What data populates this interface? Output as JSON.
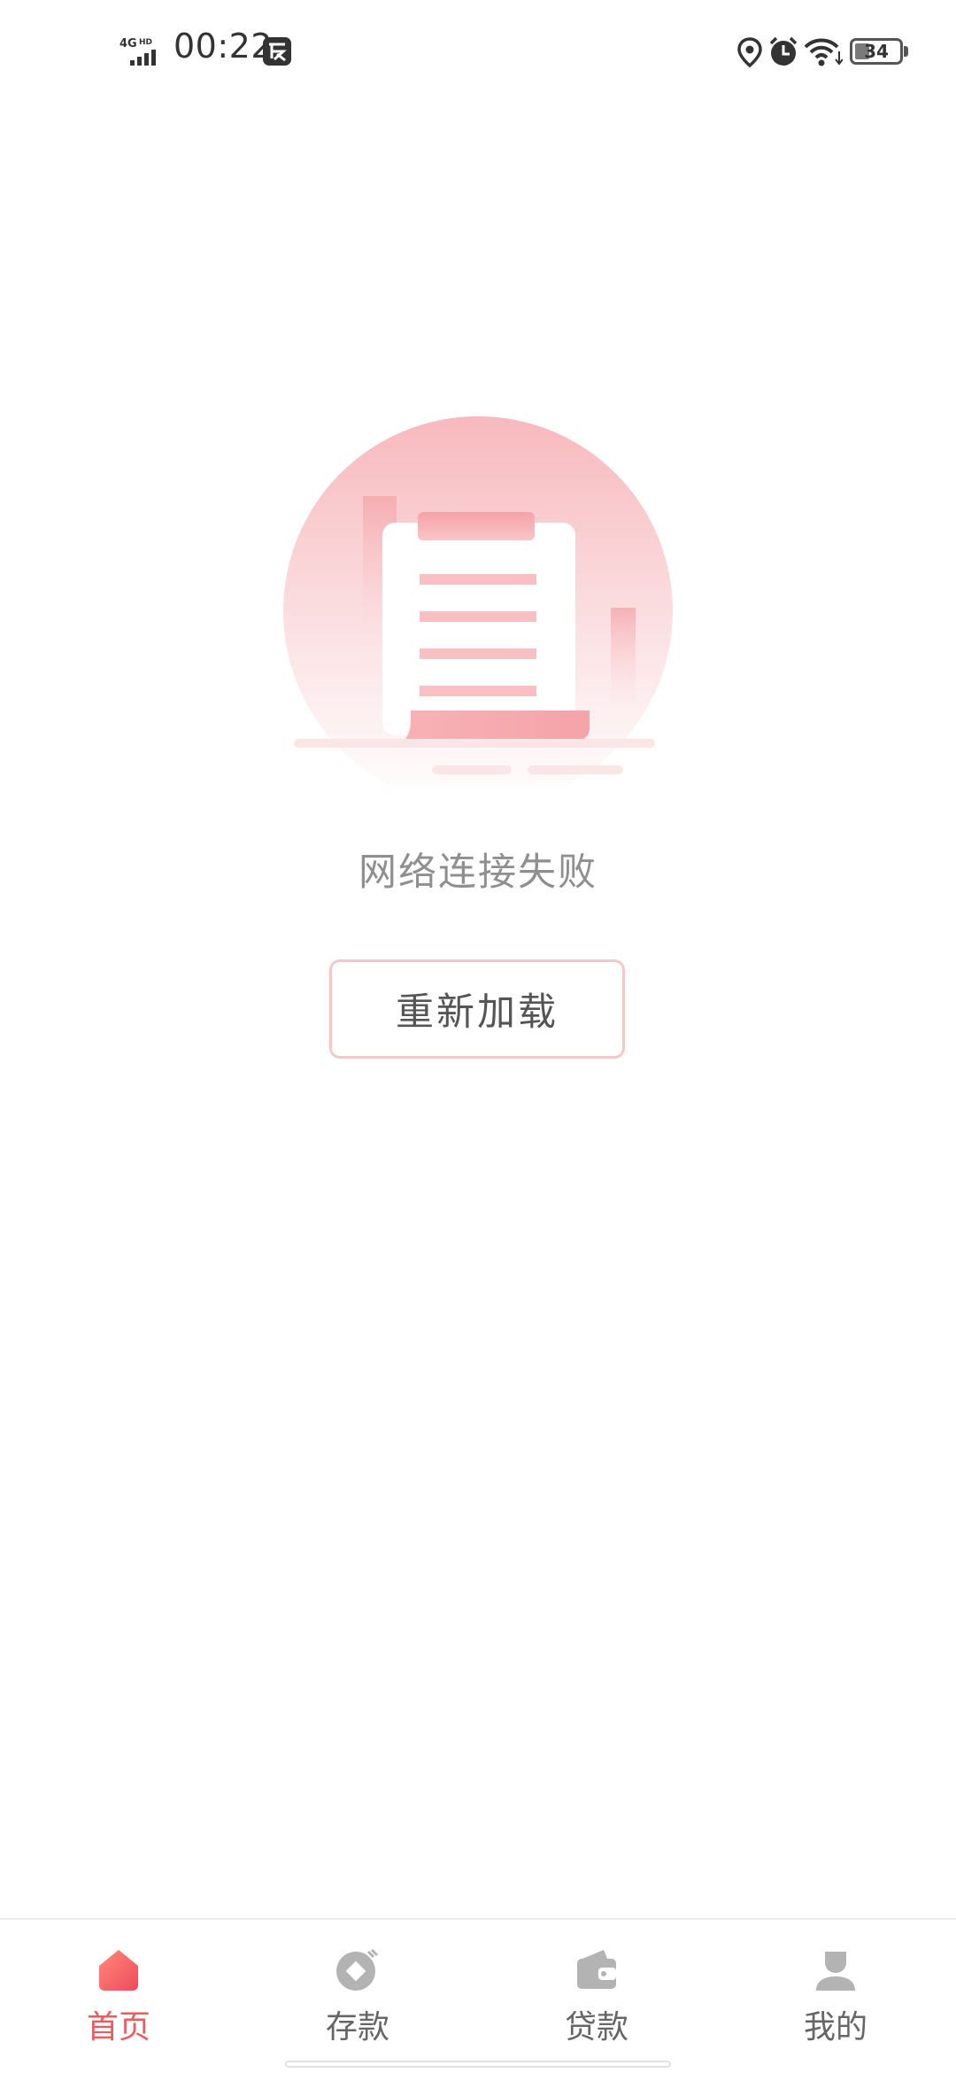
{
  "status_bar": {
    "network": "4GHD",
    "time": "00:22",
    "battery_level": "34",
    "battery_fraction": 0.34,
    "icons": [
      "signal-icon",
      "app-notification-icon",
      "location-icon",
      "alarm-icon",
      "wifi-icon",
      "battery-icon"
    ]
  },
  "illustration": {
    "icon": "document-empty-state-illustration"
  },
  "error": {
    "message": "网络连接失败"
  },
  "reload": {
    "label": "重新加载"
  },
  "colors": {
    "accent": "#f05a5f",
    "illustration_pink": "#f5aeb3",
    "button_border": "#f7c6c8",
    "inactive": "#666666"
  },
  "nav": {
    "items": [
      {
        "label": "首页",
        "icon": "home-icon",
        "active": true
      },
      {
        "label": "存款",
        "icon": "deposit-icon",
        "active": false
      },
      {
        "label": "贷款",
        "icon": "wallet-icon",
        "active": false
      },
      {
        "label": "我的",
        "icon": "profile-icon",
        "active": false
      }
    ]
  }
}
